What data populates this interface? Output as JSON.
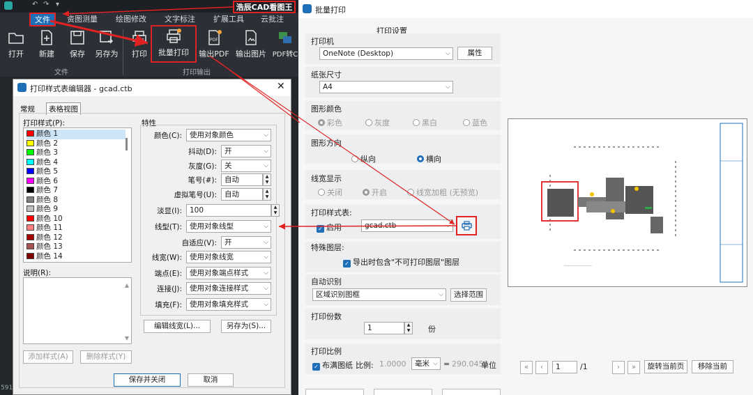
{
  "cad": {
    "app_title": "浩辰CAD看图王",
    "menus": [
      "文件",
      "资图测量",
      "绘图修改",
      "文字标注",
      "扩展工具",
      "云批注"
    ],
    "ribbon": [
      {
        "label": "打开",
        "icon": "folder-icon"
      },
      {
        "label": "新建",
        "icon": "new-file-icon"
      },
      {
        "label": "保存",
        "icon": "save-icon"
      },
      {
        "label": "另存为",
        "icon": "save-as-icon"
      },
      {
        "label": "打印",
        "icon": "printer-icon"
      },
      {
        "label": "批量打印",
        "icon": "batch-print-icon"
      },
      {
        "label": "输出PDF",
        "icon": "pdf-icon"
      },
      {
        "label": "输出图片",
        "icon": "image-export-icon"
      },
      {
        "label": "PDF转C",
        "icon": "pdf-convert-icon"
      }
    ],
    "groups": {
      "file": "文件",
      "print_output": "打印输出"
    },
    "side_text": "591"
  },
  "editor": {
    "title": "打印样式表编辑器 - gcad.ctb",
    "tabs": [
      "常规",
      "表格视图"
    ],
    "styles_label": "打印样式(P):",
    "styles": [
      {
        "name": "颜色 1",
        "color": "#ff0000"
      },
      {
        "name": "颜色 2",
        "color": "#ffff00"
      },
      {
        "name": "颜色 3",
        "color": "#00ff00"
      },
      {
        "name": "颜色 4",
        "color": "#00ffff"
      },
      {
        "name": "颜色 5",
        "color": "#0000ff"
      },
      {
        "name": "颜色 6",
        "color": "#ff00ff"
      },
      {
        "name": "颜色 7",
        "color": "#000000"
      },
      {
        "name": "颜色 8",
        "color": "#808080"
      },
      {
        "name": "颜色 9",
        "color": "#c0c0c0"
      },
      {
        "name": "颜色 10",
        "color": "#ff0000"
      },
      {
        "name": "颜色 11",
        "color": "#ff7f7f"
      },
      {
        "name": "颜色 12",
        "color": "#a50000"
      },
      {
        "name": "颜色 13",
        "color": "#a55252"
      },
      {
        "name": "颜色 14",
        "color": "#7f0000"
      }
    ],
    "desc_label": "说明(R):",
    "props_title": "特性",
    "props": [
      {
        "label": "颜色(C):",
        "value": "使用对象颜色"
      },
      {
        "label": "抖动(D):",
        "value": "开"
      },
      {
        "label": "灰度(G):",
        "value": "关"
      },
      {
        "label": "笔号(#):",
        "value": "自动"
      },
      {
        "label": "虚拟笔号(U):",
        "value": "自动"
      },
      {
        "label": "淡显(I):",
        "value": "100"
      },
      {
        "label": "线型(T):",
        "value": "使用对象线型"
      },
      {
        "label": "自适应(V):",
        "value": "开"
      },
      {
        "label": "线宽(W):",
        "value": "使用对象线宽"
      },
      {
        "label": "端点(E):",
        "value": "使用对象端点样式"
      },
      {
        "label": "连接(J):",
        "value": "使用对象连接样式"
      },
      {
        "label": "填充(F):",
        "value": "使用对象填充样式"
      }
    ],
    "edit_lw": "编辑线宽(L)...",
    "save_as": "另存为(S)...",
    "add_style": "添加样式(A)",
    "del_style": "删除样式(Y)",
    "save_close": "保存并关闭",
    "cancel": "取消"
  },
  "batch": {
    "title": "批量打印",
    "settings_title": "打印设置",
    "printer_label": "打印机",
    "printer_value": "OneNote (Desktop)",
    "props_btn": "属性",
    "paper_label": "纸张尺寸",
    "paper_value": "A4",
    "color_label": "图形颜色",
    "color_opts": [
      "彩色",
      "灰度",
      "黑白",
      "蓝色"
    ],
    "orient_label": "图形方向",
    "orient_opts": [
      "纵向",
      "横向"
    ],
    "lw_label": "线宽显示",
    "lw_opts": [
      "关闭",
      "开启",
      "线宽加粗 (无预览)"
    ],
    "ctb_label": "打印样式表:",
    "ctb_enable": "启用",
    "ctb_value": "gcad.ctb",
    "special_label": "特殊图层:",
    "special_opt": "导出时包含\"不可打印图层\"图层",
    "auto_label": "自动识别",
    "auto_value": "区域识别图框",
    "range_btn": "选择范围",
    "copies_label": "打印份数",
    "copies_value": "1",
    "copies_unit": "份",
    "scale_label": "打印比例",
    "fill_paper": "布满图纸",
    "scale_text": "比例:",
    "scale_value": "1.0000",
    "unit_value": "毫米",
    "equals": "=",
    "scale_result": "290.0455",
    "unit_label": "单位",
    "page_value": "1",
    "page_total": "/1",
    "rotate_btn": "旋转当前页",
    "remove_btn": "移除当前"
  }
}
